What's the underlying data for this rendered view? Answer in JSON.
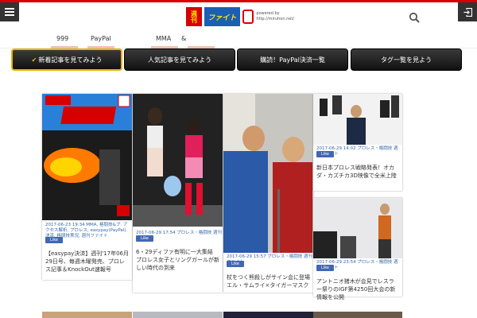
{
  "header": {
    "logo_main": "週刊",
    "logo_brand": "ファイト",
    "logo_sub": "THE WEEKLY FIGHT",
    "logo_powered": "powered by",
    "logo_domain": "http://miruhon.net/"
  },
  "nav": {
    "items": [
      "999",
      "PayPal",
      "MMA",
      "&"
    ]
  },
  "tabs": [
    {
      "label": "新着記事を見てみよう",
      "active": true
    },
    {
      "label": "人気記事を見てみよう",
      "active": false
    },
    {
      "label": "購読！PayPal決済一覧",
      "active": false
    },
    {
      "label": "タグ一覧を見よう",
      "active": false
    }
  ],
  "cards": [
    {
      "meta": "2017-06-23 19:34 MMA, 格闘技&プ. アクセス解析, プロレス, easypay(PayPal)決済, 格闘技実況, 週刊ファイト",
      "like": "Like",
      "title": "【easypay決済】週刊'17年06月29日号、毎週木曜発売、プロレス記事＆KnockOut速報号"
    },
    {
      "meta": "2017-06-29 17:54 プロレス・格闘技 週刊ファイト",
      "like": "Like",
      "title": "6・29ディファ有明に一大集結　プロレス女子とリングガールが新しい時代の到来"
    },
    {
      "meta": "2017-06-29 15:57 プロレス・格闘技 週刊ファイト",
      "like": "Like",
      "title": "杖をつく熊殺しがサイン会に登場　エル・サムライ×タイガーマスク"
    },
    {
      "meta": "2017-06-29 14:02 プロレス・格闘技 週刊ファイト",
      "like": "Like",
      "title": "新日本プロレス戦略発表！オカダ・カズチカ3D映像で全米上陸"
    },
    {
      "meta": "2017-06-29 23:54 プロレス・格闘技 週刊ファイト",
      "like": "Like",
      "title": "アントニオ猪木が会見でレスラー祭りのIGF第4250回大会の新情報を公開"
    }
  ],
  "colors": {
    "accent_red": "#d60000",
    "tab_gold": "#e5b300",
    "facebook_blue": "#4267b2",
    "meta_blue": "#3366aa"
  },
  "icons": {
    "menu": "hamburger-icon",
    "search": "search-icon",
    "login": "login-icon",
    "check": "check-icon"
  }
}
